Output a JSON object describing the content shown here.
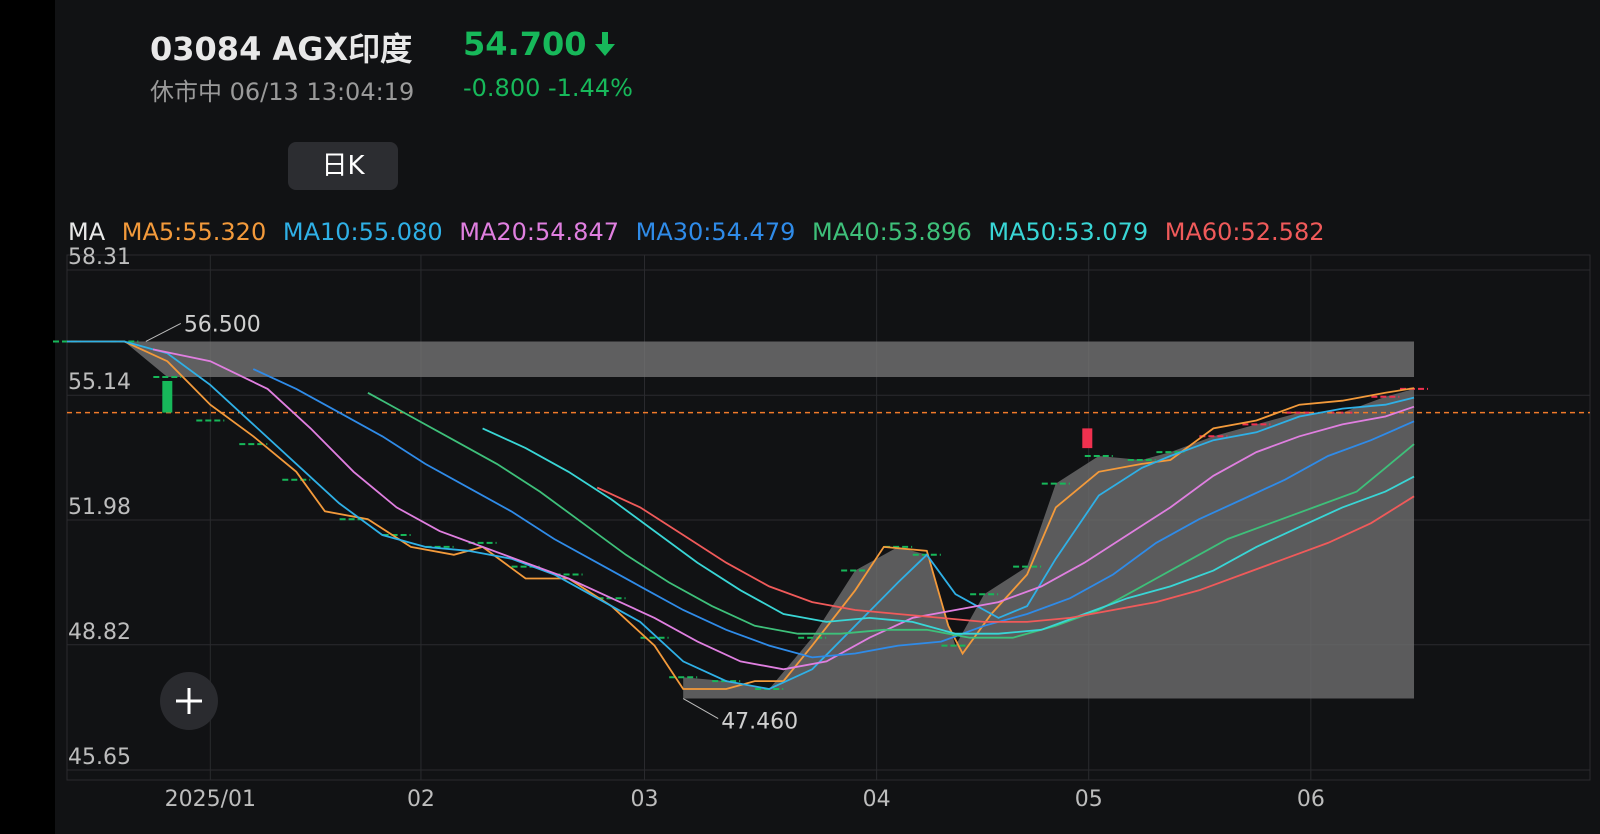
{
  "header": {
    "code_name": "03084  AGX印度",
    "status": "休市中 06/13 13:04:19",
    "price": "54.700",
    "change": "-0.800 -1.44%",
    "direction_icon": "arrow-down-icon"
  },
  "period_button": "日K",
  "ma_legend": {
    "label": "MA",
    "items": [
      {
        "text": "MA5:55.320",
        "color": "#f39a3b"
      },
      {
        "text": "MA10:55.080",
        "color": "#2fb0e6"
      },
      {
        "text": "MA20:54.847",
        "color": "#e07fe0"
      },
      {
        "text": "MA30:54.479",
        "color": "#2f8be8"
      },
      {
        "text": "MA40:53.896",
        "color": "#3ec07a"
      },
      {
        "text": "MA50:53.079",
        "color": "#39d6d6"
      },
      {
        "text": "MA60:52.582",
        "color": "#f05a5a"
      }
    ]
  },
  "colors": {
    "up": "#f0314f",
    "down": "#17b85a",
    "price_line": "#f07a2a",
    "grid": "#2a2b2e"
  },
  "chart_data": {
    "type": "line",
    "ylim": [
      45.65,
      58.31
    ],
    "y_ticks": [
      "58.31",
      "55.14",
      "51.98",
      "48.82",
      "45.65"
    ],
    "x_ticks": [
      {
        "label": "2025/01",
        "t": 0.1
      },
      {
        "label": "02",
        "t": 0.247
      },
      {
        "label": "03",
        "t": 0.403
      },
      {
        "label": "04",
        "t": 0.565
      },
      {
        "label": "05",
        "t": 0.713
      },
      {
        "label": "06",
        "t": 0.868
      }
    ],
    "high_label": "56.500",
    "low_label": "47.460",
    "current_price": 54.7,
    "x_range": [
      0,
      1
    ],
    "price_band": [
      [
        0.0,
        56.5
      ],
      [
        0.04,
        56.5
      ],
      [
        0.07,
        55.6
      ],
      [
        0.1,
        54.5
      ],
      [
        0.13,
        53.9
      ],
      [
        0.16,
        53.0
      ],
      [
        0.2,
        52.0
      ],
      [
        0.23,
        51.6
      ],
      [
        0.26,
        51.3
      ],
      [
        0.29,
        51.4
      ],
      [
        0.32,
        50.8
      ],
      [
        0.35,
        50.6
      ],
      [
        0.38,
        50.0
      ],
      [
        0.41,
        49.0
      ],
      [
        0.43,
        48.0
      ],
      [
        0.46,
        47.9
      ],
      [
        0.49,
        47.7
      ],
      [
        0.52,
        49.0
      ],
      [
        0.55,
        50.7
      ],
      [
        0.58,
        51.3
      ],
      [
        0.6,
        51.1
      ],
      [
        0.62,
        48.8
      ],
      [
        0.64,
        50.1
      ],
      [
        0.67,
        50.8
      ],
      [
        0.69,
        52.9
      ],
      [
        0.72,
        53.6
      ],
      [
        0.75,
        53.5
      ],
      [
        0.77,
        53.7
      ],
      [
        0.8,
        54.1
      ],
      [
        0.83,
        54.4
      ],
      [
        0.86,
        54.7
      ],
      [
        0.89,
        54.7
      ],
      [
        0.92,
        55.1
      ],
      [
        0.94,
        55.3
      ]
    ],
    "series": [
      {
        "name": "MA5",
        "color": "#f39a3b",
        "values": [
          [
            0.0,
            56.5
          ],
          [
            0.04,
            56.5
          ],
          [
            0.07,
            56.0
          ],
          [
            0.1,
            54.9
          ],
          [
            0.13,
            54.1
          ],
          [
            0.16,
            53.2
          ],
          [
            0.18,
            52.2
          ],
          [
            0.21,
            52.0
          ],
          [
            0.24,
            51.3
          ],
          [
            0.27,
            51.1
          ],
          [
            0.29,
            51.3
          ],
          [
            0.32,
            50.5
          ],
          [
            0.35,
            50.5
          ],
          [
            0.38,
            49.8
          ],
          [
            0.41,
            48.8
          ],
          [
            0.43,
            47.7
          ],
          [
            0.46,
            47.7
          ],
          [
            0.48,
            47.9
          ],
          [
            0.5,
            47.9
          ],
          [
            0.52,
            48.8
          ],
          [
            0.55,
            50.2
          ],
          [
            0.57,
            51.3
          ],
          [
            0.6,
            51.2
          ],
          [
            0.615,
            49.3
          ],
          [
            0.625,
            48.6
          ],
          [
            0.645,
            49.6
          ],
          [
            0.67,
            50.6
          ],
          [
            0.69,
            52.3
          ],
          [
            0.72,
            53.2
          ],
          [
            0.75,
            53.4
          ],
          [
            0.77,
            53.5
          ],
          [
            0.8,
            54.3
          ],
          [
            0.83,
            54.5
          ],
          [
            0.86,
            54.9
          ],
          [
            0.89,
            55.0
          ],
          [
            0.92,
            55.2
          ],
          [
            0.94,
            55.32
          ]
        ]
      },
      {
        "name": "MA10",
        "color": "#2fb0e6",
        "values": [
          [
            0.0,
            56.5
          ],
          [
            0.04,
            56.5
          ],
          [
            0.07,
            56.2
          ],
          [
            0.1,
            55.4
          ],
          [
            0.13,
            54.4
          ],
          [
            0.16,
            53.4
          ],
          [
            0.19,
            52.4
          ],
          [
            0.22,
            51.6
          ],
          [
            0.25,
            51.3
          ],
          [
            0.28,
            51.2
          ],
          [
            0.31,
            51.0
          ],
          [
            0.34,
            50.6
          ],
          [
            0.37,
            50.0
          ],
          [
            0.4,
            49.4
          ],
          [
            0.43,
            48.4
          ],
          [
            0.46,
            47.9
          ],
          [
            0.49,
            47.7
          ],
          [
            0.52,
            48.2
          ],
          [
            0.55,
            49.3
          ],
          [
            0.58,
            50.4
          ],
          [
            0.6,
            51.1
          ],
          [
            0.62,
            50.1
          ],
          [
            0.65,
            49.5
          ],
          [
            0.67,
            49.8
          ],
          [
            0.69,
            51.0
          ],
          [
            0.72,
            52.6
          ],
          [
            0.75,
            53.3
          ],
          [
            0.77,
            53.6
          ],
          [
            0.8,
            54.0
          ],
          [
            0.83,
            54.2
          ],
          [
            0.86,
            54.6
          ],
          [
            0.89,
            54.8
          ],
          [
            0.92,
            54.9
          ],
          [
            0.94,
            55.08
          ]
        ]
      },
      {
        "name": "MA20",
        "color": "#e07fe0",
        "values": [
          [
            0.06,
            56.3
          ],
          [
            0.1,
            56.0
          ],
          [
            0.14,
            55.3
          ],
          [
            0.17,
            54.3
          ],
          [
            0.2,
            53.2
          ],
          [
            0.23,
            52.3
          ],
          [
            0.26,
            51.7
          ],
          [
            0.29,
            51.3
          ],
          [
            0.32,
            50.9
          ],
          [
            0.35,
            50.5
          ],
          [
            0.38,
            50.0
          ],
          [
            0.41,
            49.5
          ],
          [
            0.44,
            48.9
          ],
          [
            0.47,
            48.4
          ],
          [
            0.5,
            48.2
          ],
          [
            0.53,
            48.4
          ],
          [
            0.56,
            49.0
          ],
          [
            0.59,
            49.5
          ],
          [
            0.62,
            49.7
          ],
          [
            0.65,
            49.9
          ],
          [
            0.68,
            50.3
          ],
          [
            0.71,
            50.9
          ],
          [
            0.74,
            51.6
          ],
          [
            0.77,
            52.3
          ],
          [
            0.8,
            53.1
          ],
          [
            0.83,
            53.7
          ],
          [
            0.86,
            54.1
          ],
          [
            0.89,
            54.4
          ],
          [
            0.92,
            54.6
          ],
          [
            0.94,
            54.85
          ]
        ]
      },
      {
        "name": "MA30",
        "color": "#2f8be8",
        "values": [
          [
            0.13,
            55.8
          ],
          [
            0.16,
            55.3
          ],
          [
            0.19,
            54.7
          ],
          [
            0.22,
            54.1
          ],
          [
            0.25,
            53.4
          ],
          [
            0.28,
            52.8
          ],
          [
            0.31,
            52.2
          ],
          [
            0.34,
            51.5
          ],
          [
            0.37,
            50.9
          ],
          [
            0.4,
            50.3
          ],
          [
            0.43,
            49.7
          ],
          [
            0.46,
            49.2
          ],
          [
            0.49,
            48.8
          ],
          [
            0.52,
            48.5
          ],
          [
            0.55,
            48.6
          ],
          [
            0.58,
            48.8
          ],
          [
            0.61,
            48.9
          ],
          [
            0.64,
            49.3
          ],
          [
            0.67,
            49.6
          ],
          [
            0.7,
            50.0
          ],
          [
            0.73,
            50.6
          ],
          [
            0.76,
            51.4
          ],
          [
            0.79,
            52.0
          ],
          [
            0.82,
            52.5
          ],
          [
            0.85,
            53.0
          ],
          [
            0.88,
            53.6
          ],
          [
            0.91,
            54.0
          ],
          [
            0.94,
            54.48
          ]
        ]
      },
      {
        "name": "MA40",
        "color": "#3ec07a",
        "values": [
          [
            0.21,
            55.2
          ],
          [
            0.24,
            54.6
          ],
          [
            0.27,
            54.0
          ],
          [
            0.3,
            53.4
          ],
          [
            0.33,
            52.7
          ],
          [
            0.36,
            51.9
          ],
          [
            0.39,
            51.1
          ],
          [
            0.42,
            50.4
          ],
          [
            0.45,
            49.8
          ],
          [
            0.48,
            49.3
          ],
          [
            0.51,
            49.1
          ],
          [
            0.54,
            49.1
          ],
          [
            0.57,
            49.2
          ],
          [
            0.6,
            49.2
          ],
          [
            0.63,
            49.0
          ],
          [
            0.66,
            49.0
          ],
          [
            0.69,
            49.3
          ],
          [
            0.72,
            49.7
          ],
          [
            0.75,
            50.3
          ],
          [
            0.78,
            50.9
          ],
          [
            0.81,
            51.5
          ],
          [
            0.84,
            51.9
          ],
          [
            0.87,
            52.3
          ],
          [
            0.9,
            52.7
          ],
          [
            0.92,
            53.3
          ],
          [
            0.94,
            53.9
          ]
        ]
      },
      {
        "name": "MA50",
        "color": "#39d6d6",
        "values": [
          [
            0.29,
            54.3
          ],
          [
            0.32,
            53.8
          ],
          [
            0.35,
            53.2
          ],
          [
            0.38,
            52.5
          ],
          [
            0.41,
            51.7
          ],
          [
            0.44,
            50.9
          ],
          [
            0.47,
            50.2
          ],
          [
            0.5,
            49.6
          ],
          [
            0.53,
            49.4
          ],
          [
            0.56,
            49.5
          ],
          [
            0.59,
            49.4
          ],
          [
            0.62,
            49.1
          ],
          [
            0.65,
            49.1
          ],
          [
            0.68,
            49.2
          ],
          [
            0.71,
            49.6
          ],
          [
            0.74,
            50.0
          ],
          [
            0.77,
            50.3
          ],
          [
            0.8,
            50.7
          ],
          [
            0.83,
            51.3
          ],
          [
            0.86,
            51.8
          ],
          [
            0.89,
            52.3
          ],
          [
            0.92,
            52.7
          ],
          [
            0.94,
            53.08
          ]
        ]
      },
      {
        "name": "MA60",
        "color": "#f05a5a",
        "values": [
          [
            0.37,
            52.8
          ],
          [
            0.4,
            52.3
          ],
          [
            0.43,
            51.6
          ],
          [
            0.46,
            50.9
          ],
          [
            0.49,
            50.3
          ],
          [
            0.52,
            49.9
          ],
          [
            0.55,
            49.7
          ],
          [
            0.58,
            49.6
          ],
          [
            0.61,
            49.5
          ],
          [
            0.64,
            49.4
          ],
          [
            0.67,
            49.4
          ],
          [
            0.7,
            49.5
          ],
          [
            0.73,
            49.7
          ],
          [
            0.76,
            49.9
          ],
          [
            0.79,
            50.2
          ],
          [
            0.82,
            50.6
          ],
          [
            0.85,
            51.0
          ],
          [
            0.88,
            51.4
          ],
          [
            0.91,
            51.9
          ],
          [
            0.94,
            52.58
          ]
        ]
      }
    ],
    "candles": [
      {
        "t": 0.07,
        "open": 55.5,
        "close": 54.7,
        "dir": "down"
      },
      {
        "t": 0.712,
        "open": 53.8,
        "close": 54.3,
        "dir": "up"
      }
    ]
  }
}
